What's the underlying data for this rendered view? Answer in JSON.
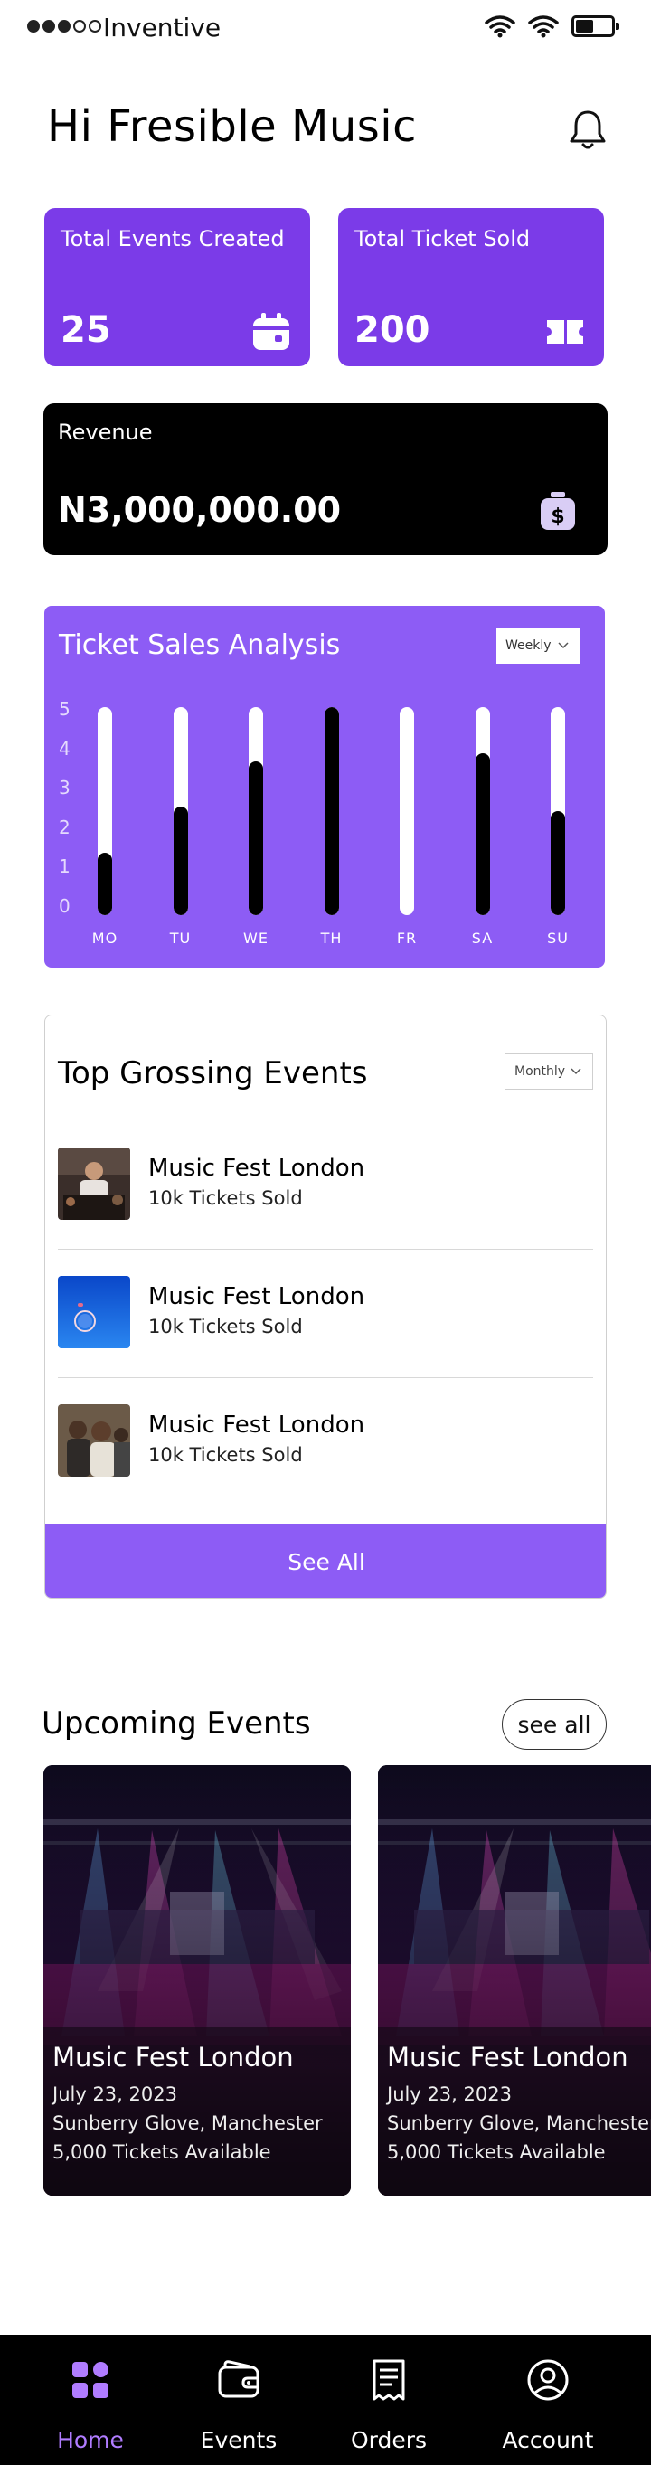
{
  "status_bar": {
    "carrier": "Inventive",
    "signal_bars_filled": 3,
    "signal_bars_total": 5,
    "battery_level": 0.5
  },
  "header": {
    "greeting": "Hi Fresible Music",
    "notification_icon": "bell-icon"
  },
  "stats": {
    "events_created": {
      "label": "Total Events Created",
      "value": "25",
      "icon": "calendar-icon"
    },
    "tickets_sold": {
      "label": "Total Ticket Sold",
      "value": "200",
      "icon": "ticket-icon"
    },
    "revenue": {
      "label": "Revenue",
      "value": "N3,000,000.00",
      "icon": "money-bag-icon"
    }
  },
  "colors": {
    "accent": "#7b3be8",
    "chart_bg": "#8d5cf5",
    "nav_active": "#b07cff",
    "revenue_bg": "#000000"
  },
  "ticket_sales": {
    "title": "Ticket Sales Analysis",
    "filter": "Weekly"
  },
  "chart_data": {
    "type": "bar",
    "title": "Ticket Sales Analysis",
    "categories": [
      "MO",
      "TU",
      "WE",
      "TH",
      "FR",
      "SA",
      "SU"
    ],
    "values": [
      1.5,
      2.6,
      3.7,
      5,
      0,
      3.9,
      2.5
    ],
    "y_ticks": [
      "5",
      "4",
      "3",
      "2",
      "1",
      "0"
    ],
    "ylim": [
      0,
      5
    ],
    "grid": false,
    "legend": "none"
  },
  "top_grossing": {
    "title": "Top Grossing Events",
    "filter": "Monthly",
    "events": [
      {
        "name": "Music Fest London",
        "tickets": "10k Tickets Sold"
      },
      {
        "name": "Music Fest London",
        "tickets": "10k Tickets Sold"
      },
      {
        "name": "Music Fest London",
        "tickets": "10k Tickets Sold"
      }
    ],
    "see_all": "See All"
  },
  "upcoming": {
    "title": "Upcoming Events",
    "see_all": "see all",
    "events": [
      {
        "name": "Music Fest London",
        "date": "July 23, 2023",
        "venue": "Sunberry Glove, Manchester",
        "availability": "5,000 Tickets Available"
      },
      {
        "name": "Music Fest London",
        "date": "July 23, 2023",
        "venue": "Sunberry Glove, Manchester",
        "availability": "5,000 Tickets Available"
      }
    ]
  },
  "nav": {
    "items": [
      {
        "label": "Home",
        "icon": "home-grid-icon",
        "active": true
      },
      {
        "label": "Events",
        "icon": "wallet-icon",
        "active": false
      },
      {
        "label": "Orders",
        "icon": "receipt-icon",
        "active": false
      },
      {
        "label": "Account",
        "icon": "user-circle-icon",
        "active": false
      }
    ]
  }
}
